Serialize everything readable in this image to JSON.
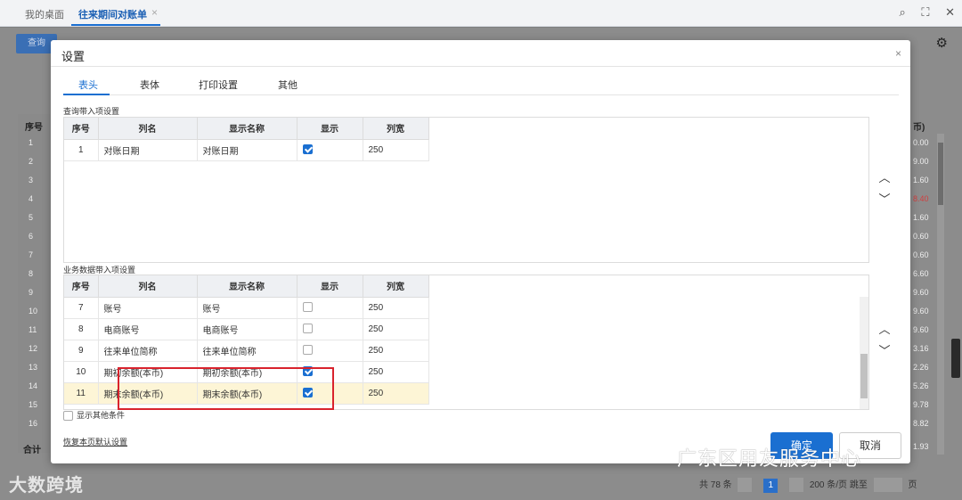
{
  "topbar": {
    "home_tab": "我的桌面",
    "active_tab": "往来期间对账单",
    "close_glyph": "×",
    "search_icon": "search-icon",
    "fullscreen_icon": "fullscreen-icon",
    "close_icon": "close-icon"
  },
  "background": {
    "query_button": "查询",
    "grid_header_no": "序号",
    "row_numbers": [
      "1",
      "2",
      "3",
      "4",
      "5",
      "6",
      "7",
      "8",
      "9",
      "10",
      "11",
      "12",
      "13",
      "14",
      "15",
      "16"
    ],
    "total_label": "合计",
    "right_header": "币)",
    "right_values": [
      "0.00",
      "9.00",
      "1.60",
      "8.40",
      "1.60",
      "0.60",
      "0.60",
      "6.60",
      "9.60",
      "9.60",
      "9.60",
      "3.16",
      "2.26",
      "5.26",
      "9.78",
      "8.82"
    ],
    "right_values_colors": [
      "#eeeeee",
      "#eeeeee",
      "#eeeeee",
      "#d04040",
      "#eeeeee",
      "#eeeeee",
      "#eeeeee",
      "#eeeeee",
      "#eeeeee",
      "#eeeeee",
      "#eeeeee",
      "#eeeeee",
      "#eeeeee",
      "#eeeeee",
      "#eeeeee",
      "#eeeeee"
    ],
    "right_total": "1.93",
    "pager": {
      "total": "共 78 条",
      "current_page": "1",
      "page_size": "200 条/页",
      "jump_label": "跳至",
      "page_suffix": "页"
    }
  },
  "watermarks": {
    "bottom_left": "大数跨境",
    "bottom_right": "广东区用友服务中心"
  },
  "dialog": {
    "title": "设置",
    "close_glyph": "×",
    "tabs": [
      "表头",
      "表体",
      "打印设置",
      "其他"
    ],
    "active_tab_index": 0,
    "query_section": {
      "label": "查询带入项设置",
      "headers": [
        "序号",
        "列名",
        "显示名称",
        "显示",
        "列宽"
      ],
      "rows": [
        {
          "no": "1",
          "name": "对账日期",
          "display": "对账日期",
          "show": true,
          "width": "250"
        }
      ]
    },
    "business_section": {
      "label": "业务数据带入项设置",
      "headers": [
        "序号",
        "列名",
        "显示名称",
        "显示",
        "列宽"
      ],
      "rows": [
        {
          "no": "7",
          "name": "账号",
          "display": "账号",
          "show": false,
          "width": "250"
        },
        {
          "no": "8",
          "name": "电商账号",
          "display": "电商账号",
          "show": false,
          "width": "250"
        },
        {
          "no": "9",
          "name": "往来单位简称",
          "display": "往来单位简称",
          "show": false,
          "width": "250"
        },
        {
          "no": "10",
          "name": "期初余额(本币)",
          "display": "期初余额(本币)",
          "show": true,
          "width": "250"
        },
        {
          "no": "11",
          "name": "期末余额(本币)",
          "display": "期末余额(本币)",
          "show": true,
          "width": "250",
          "highlighted": true
        }
      ]
    },
    "show_more_label": "显示其他条件",
    "show_more_checked": false,
    "restore_link": "恢复本页默认设置",
    "ok_button": "确定",
    "cancel_button": "取消",
    "accent_color": "#1a6fd1",
    "annotation_color": "#d9232d"
  }
}
